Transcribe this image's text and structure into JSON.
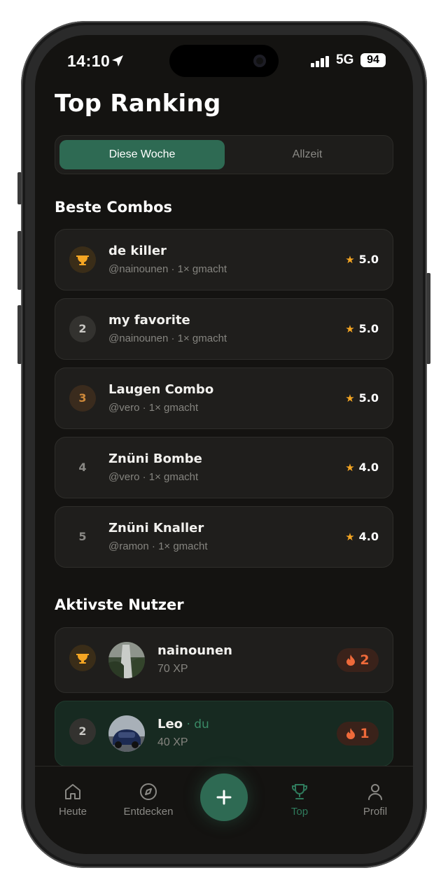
{
  "status": {
    "time": "14:10",
    "network": "5G",
    "battery": "94"
  },
  "page": {
    "title": "Top Ranking"
  },
  "segment": {
    "active": "Diese Woche",
    "inactive": "Allzeit"
  },
  "combos": {
    "heading": "Beste Combos",
    "items": [
      {
        "rank": "",
        "name": "de killer",
        "sub": "@nainounen · 1× gmacht",
        "score": "5.0"
      },
      {
        "rank": "2",
        "name": "my favorite",
        "sub": "@nainounen · 1× gmacht",
        "score": "5.0"
      },
      {
        "rank": "3",
        "name": "Laugen Combo",
        "sub": "@vero · 1× gmacht",
        "score": "5.0"
      },
      {
        "rank": "4",
        "name": "Znüni Bombe",
        "sub": "@vero · 1× gmacht",
        "score": "4.0"
      },
      {
        "rank": "5",
        "name": "Znüni Knaller",
        "sub": "@ramon · 1× gmacht",
        "score": "4.0"
      }
    ]
  },
  "users": {
    "heading": "Aktivste Nutzer",
    "items": [
      {
        "rank": "",
        "name": "nainounen",
        "you": "",
        "xp": "70 XP",
        "streak": "2"
      },
      {
        "rank": "2",
        "name": "Leo",
        "you": " · du",
        "xp": "40 XP",
        "streak": "1"
      }
    ]
  },
  "tabs": {
    "today": "Heute",
    "discover": "Entdecken",
    "top": "Top",
    "profile": "Profil"
  },
  "colors": {
    "accent": "#2e6a53",
    "star": "#f5a623",
    "streak": "#ef6a3a",
    "background": "#141311"
  }
}
